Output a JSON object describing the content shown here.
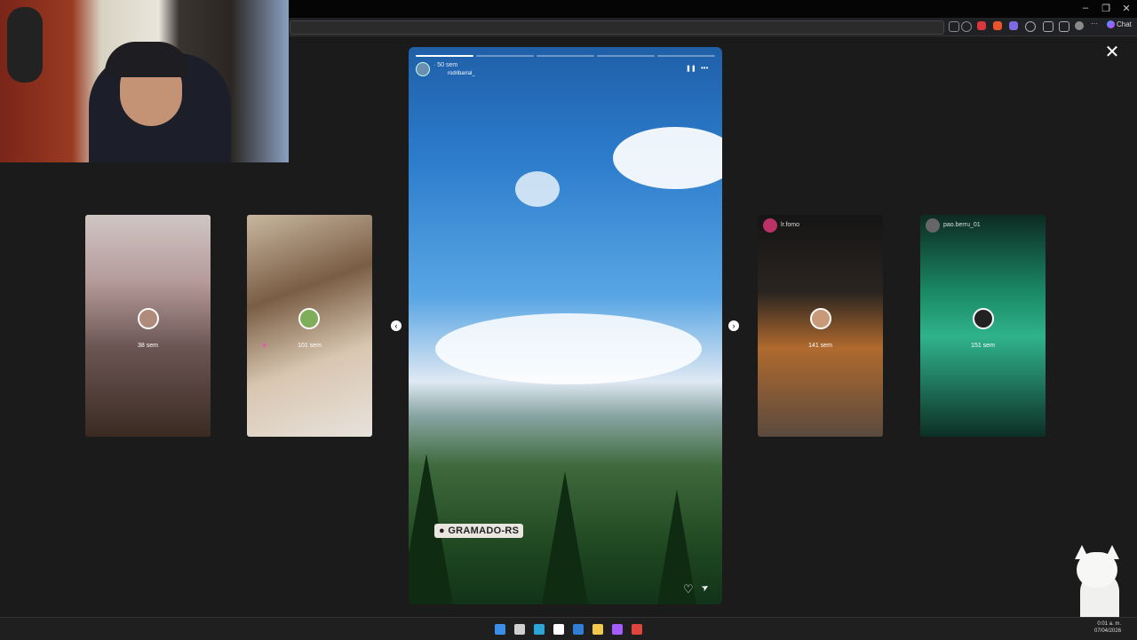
{
  "window": {
    "minimize_icon": "minimize-icon",
    "maximize_icon": "restore-icon",
    "close_icon": "close-icon",
    "minimize_glyph": "–",
    "restore_glyph": "❐",
    "close_glyph": "✕"
  },
  "browser": {
    "chat_label": "Chat"
  },
  "viewer": {
    "close_glyph": "✕",
    "prev_glyph": "‹",
    "next_glyph": "›"
  },
  "thumbnails": [
    {
      "time_ago": "38 sem",
      "username": ""
    },
    {
      "time_ago": "101 sem",
      "username": ""
    },
    {
      "time_ago": "141 sem",
      "username": "lr.fomo"
    },
    {
      "time_ago": "151 sem",
      "username": "pao.berru_01"
    }
  ],
  "story": {
    "time_ago": "· 50 sem",
    "username": "rodribarral_",
    "location_tag": "GRAMADO-RS",
    "pause_glyph": "❚❚",
    "more_glyph": "•••",
    "like_glyph": "♡",
    "share_glyph": "➤",
    "segments_total": 5,
    "segments_viewed": 1
  },
  "taskbar": {
    "icons": [
      "windows-start-icon",
      "task-view-icon",
      "edge-icon",
      "store-icon",
      "mail-icon",
      "file-explorer-icon",
      "messenger-icon",
      "media-app-icon"
    ],
    "clock_time": "0:01 a. m.",
    "clock_date": "07/04/2026"
  },
  "colors": {
    "accent": "#ffffff",
    "stage_bg": "#1b1b1b",
    "location_tag_bg": "#e9e6e0"
  }
}
